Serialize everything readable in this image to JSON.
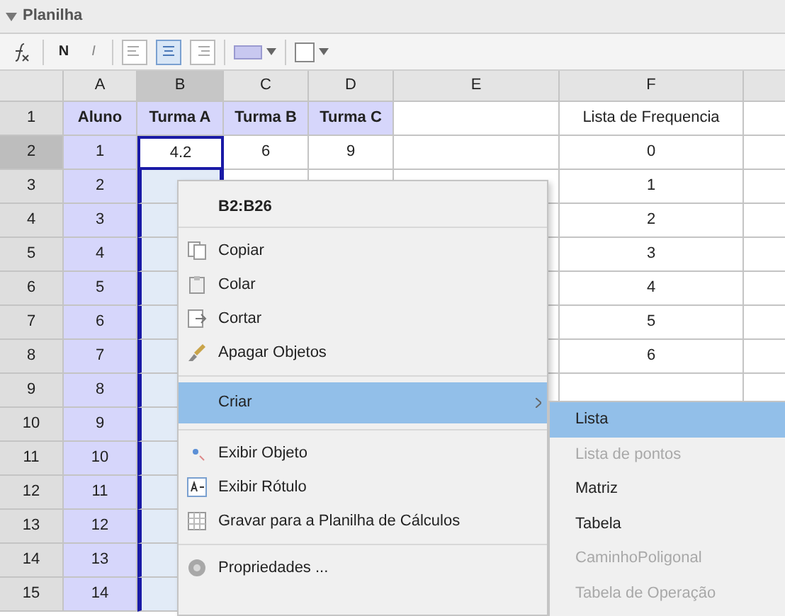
{
  "panel": {
    "title": "Planilha",
    "expanded": true
  },
  "toolbar": {
    "bold_label": "N",
    "italic_label": "I",
    "align": [
      {
        "selected": false
      },
      {
        "selected": true
      },
      {
        "selected": false
      }
    ]
  },
  "columns": [
    {
      "label": "A",
      "selected": false
    },
    {
      "label": "B",
      "selected": true
    },
    {
      "label": "C",
      "selected": false
    },
    {
      "label": "D",
      "selected": false
    },
    {
      "label": "E",
      "selected": false
    },
    {
      "label": "F",
      "selected": false
    }
  ],
  "rows": [
    {
      "number": "1",
      "selected": false,
      "cells": {
        "A": {
          "text": "Aluno",
          "shaded": true
        },
        "B": {
          "text": "Turma A",
          "shaded": true
        },
        "C": {
          "text": "Turma B",
          "shaded": true
        },
        "D": {
          "text": "Turma C",
          "shaded": true
        },
        "F": {
          "text": "Lista de Frequencia",
          "shaded": false
        }
      }
    },
    {
      "number": "2",
      "selected": true,
      "cells": {
        "A": {
          "text": "1",
          "shaded": true
        },
        "B": {
          "text": "4.2",
          "shaded": false
        },
        "C": {
          "text": "6",
          "shaded": false
        },
        "D": {
          "text": "9",
          "shaded": false
        },
        "F": {
          "text": "0",
          "shaded": false
        }
      }
    },
    {
      "number": "3",
      "selected": false,
      "cells": {
        "A": {
          "text": "2",
          "shaded": true
        },
        "F": {
          "text": "1",
          "shaded": false
        }
      }
    },
    {
      "number": "4",
      "selected": false,
      "cells": {
        "A": {
          "text": "3",
          "shaded": true
        },
        "F": {
          "text": "2",
          "shaded": false
        }
      }
    },
    {
      "number": "5",
      "selected": false,
      "cells": {
        "A": {
          "text": "4",
          "shaded": true
        },
        "F": {
          "text": "3",
          "shaded": false
        }
      }
    },
    {
      "number": "6",
      "selected": false,
      "cells": {
        "A": {
          "text": "5",
          "shaded": true
        },
        "F": {
          "text": "4",
          "shaded": false
        }
      }
    },
    {
      "number": "7",
      "selected": false,
      "cells": {
        "A": {
          "text": "6",
          "shaded": true
        },
        "F": {
          "text": "5",
          "shaded": false
        }
      }
    },
    {
      "number": "8",
      "selected": false,
      "cells": {
        "A": {
          "text": "7",
          "shaded": true
        },
        "F": {
          "text": "6",
          "shaded": false
        }
      }
    },
    {
      "number": "9",
      "selected": false,
      "cells": {
        "A": {
          "text": "8",
          "shaded": true
        }
      }
    },
    {
      "number": "10",
      "selected": false,
      "cells": {
        "A": {
          "text": "9",
          "shaded": true
        }
      }
    },
    {
      "number": "11",
      "selected": false,
      "cells": {
        "A": {
          "text": "10",
          "shaded": true
        }
      }
    },
    {
      "number": "12",
      "selected": false,
      "cells": {
        "A": {
          "text": "11",
          "shaded": true
        }
      }
    },
    {
      "number": "13",
      "selected": false,
      "cells": {
        "A": {
          "text": "12",
          "shaded": true
        }
      }
    },
    {
      "number": "14",
      "selected": false,
      "cells": {
        "A": {
          "text": "13",
          "shaded": true
        }
      }
    },
    {
      "number": "15",
      "selected": false,
      "cells": {
        "A": {
          "text": "14",
          "shaded": true
        }
      }
    }
  ],
  "context_menu": {
    "title": "B2:B26",
    "items": [
      {
        "kind": "separator"
      },
      {
        "kind": "copy",
        "label": "Copiar",
        "selected": false
      },
      {
        "kind": "paste",
        "label": "Colar",
        "selected": false
      },
      {
        "kind": "cut",
        "label": "Cortar",
        "selected": false
      },
      {
        "kind": "erase",
        "label": "Apagar Objetos",
        "selected": false
      },
      {
        "kind": "separator"
      },
      {
        "kind": "submenu",
        "label": "Criar",
        "selected": true
      },
      {
        "kind": "separator"
      },
      {
        "kind": "show",
        "label": "Exibir Objeto",
        "selected": false
      },
      {
        "kind": "label",
        "label": "Exibir Rótulo",
        "selected": false
      },
      {
        "kind": "record",
        "label": "Gravar para a Planilha de Cálculos",
        "selected": false
      },
      {
        "kind": "separator"
      },
      {
        "kind": "properties",
        "label": "Propriedades ...",
        "selected": false
      }
    ]
  },
  "submenu": {
    "items": [
      {
        "label": "Lista",
        "selected": true,
        "disabled": false
      },
      {
        "label": "Lista de pontos",
        "selected": false,
        "disabled": true
      },
      {
        "label": "Matriz",
        "selected": false,
        "disabled": false
      },
      {
        "label": "Tabela",
        "selected": false,
        "disabled": false
      },
      {
        "label": "CaminhoPoligonal",
        "selected": false,
        "disabled": true
      },
      {
        "label": "Tabela de Operação",
        "selected": false,
        "disabled": true
      }
    ]
  }
}
